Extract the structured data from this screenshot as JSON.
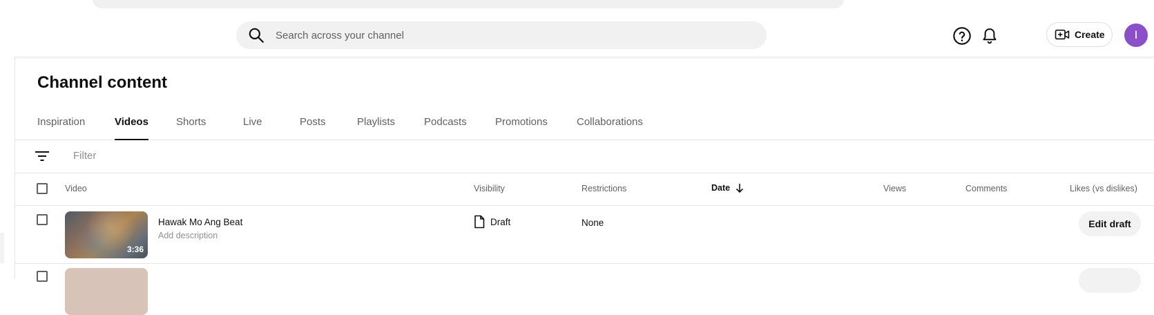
{
  "header": {
    "search_placeholder": "Search across your channel",
    "create_label": "Create",
    "avatar_letter": "I",
    "avatar_color": "#8b4fc9"
  },
  "page_title": "Channel content",
  "tabs": [
    {
      "label": "Inspiration",
      "active": false
    },
    {
      "label": "Videos",
      "active": true
    },
    {
      "label": "Shorts",
      "active": false
    },
    {
      "label": "Live",
      "active": false
    },
    {
      "label": "Posts",
      "active": false
    },
    {
      "label": "Playlists",
      "active": false
    },
    {
      "label": "Podcasts",
      "active": false
    },
    {
      "label": "Promotions",
      "active": false
    },
    {
      "label": "Collaborations",
      "active": false
    }
  ],
  "filter": {
    "placeholder": "Filter"
  },
  "table": {
    "columns": {
      "video": "Video",
      "visibility": "Visibility",
      "restrictions": "Restrictions",
      "date": "Date",
      "views": "Views",
      "comments": "Comments",
      "likes": "Likes (vs dislikes)"
    },
    "date_sort": "descending",
    "rows": [
      {
        "title": "Hawak Mo Ang Beat",
        "description": "Add description",
        "duration": "3:36",
        "visibility": "Draft",
        "restrictions": "None",
        "action": "Edit draft"
      }
    ]
  }
}
